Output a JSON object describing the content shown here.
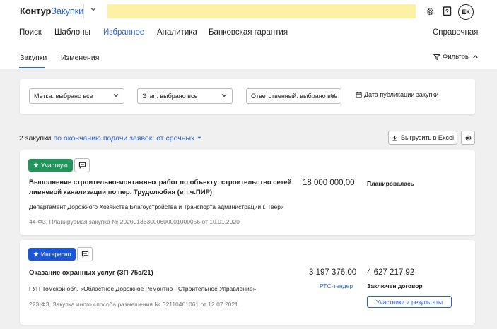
{
  "header": {
    "logo_part1": "Контур",
    "logo_part2": "Закупки",
    "user_initials": "ЕК"
  },
  "nav": {
    "items": [
      "Поиск",
      "Шаблоны",
      "Избранное",
      "Аналитика",
      "Банковская гарантия"
    ],
    "active": "Избранное",
    "reference": "Справочная"
  },
  "subtabs": {
    "items": [
      "Закупки",
      "Изменения"
    ],
    "active": "Закупки",
    "filters_label": "Фильтры"
  },
  "filters": {
    "label_select": "Метка: выбрано все",
    "stage_select": "Этап: выбрано все",
    "responsible_select": "Ответственный: выбрано все",
    "date_filter": "Дата публикации закупки"
  },
  "list": {
    "count": "2 закупки",
    "sort": "по окончанию подачи заявок: от срочных",
    "export": "Выгрузить в Excel"
  },
  "cards": [
    {
      "tag": "Участвую",
      "tag_color": "#21965c",
      "title_line1": "Выполнение строительно-монтажных работ по объекту: строительство сетей",
      "title_line2": "ливневой канализации по пер. Трудолюбия (в т.ч.ПИР)",
      "price": "18 000 000,00",
      "status": "Планировалась",
      "org": "Департамент Дорожного Хозяйства,Благоустройства и Транспорта администрации г. Твери",
      "meta": "44-ФЗ, Планируемая закупка № 202001363000600001000056 от 10.01.2020"
    },
    {
      "tag": "Интересно",
      "tag_color": "#1a56d6",
      "title_line1": "Оказание охранных услуг (ЗП-75э/21)",
      "price": "3 197 376,00",
      "platform": "РТС-тендер",
      "contract_price": "4 627 217,92",
      "status": "Заключен договор",
      "participants_button": "Участники и результаты",
      "org": "ГУП Томской обл. «Областное Дорожное Ремонтно - Строительное Управление»",
      "meta": "223-ФЗ, Закупка иного способа размещения № 32110461061 от 12.07.2021"
    }
  ]
}
